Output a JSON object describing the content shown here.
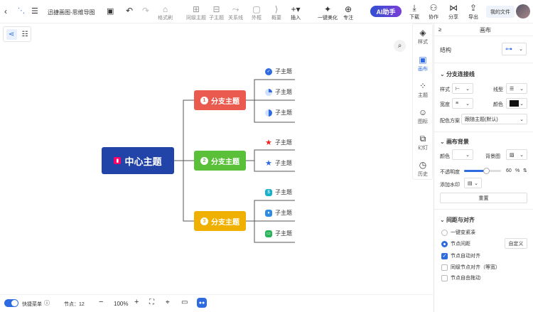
{
  "toolbar": {
    "title": "迅捷画图-思维导图",
    "tools": [
      "格式刷",
      "同级主题",
      "子主题",
      "关系线",
      "外框",
      "概要",
      "插入",
      "一键美化",
      "专注"
    ],
    "ai_label": "AI助手",
    "right": [
      "下载",
      "协作",
      "分享",
      "导出"
    ],
    "my_files": "我的文件"
  },
  "mindmap": {
    "center": "中心主题",
    "branches": [
      {
        "num": "1",
        "label": "分支主题",
        "color": "#ea5a4f",
        "subs": [
          "子主题",
          "子主题",
          "子主题"
        ]
      },
      {
        "num": "2",
        "label": "分支主题",
        "color": "#5ac039",
        "subs": [
          "子主题",
          "子主题"
        ]
      },
      {
        "num": "3",
        "label": "分支主题",
        "color": "#f0b000",
        "subs": [
          "子主题",
          "子主题",
          "子主题"
        ]
      }
    ]
  },
  "side_tabs": [
    "样式",
    "画布",
    "主题",
    "图标",
    "幻灯",
    "历史"
  ],
  "panel": {
    "header": "画布",
    "structure": "结构",
    "sec_lines": "分支连接线",
    "style": "样式",
    "line_type": "线型",
    "width": "宽度",
    "color": "颜色",
    "scheme": "配色方案",
    "scheme_value": "跟随主题(默认)",
    "sec_bg": "画布背景",
    "bg_color": "颜色",
    "bg_image": "背景图",
    "opacity": "不透明度",
    "opacity_value": "60",
    "opacity_unit": "%",
    "watermark": "添加水印",
    "reset": "重置",
    "sec_spacing": "间距与对齐",
    "compact": "一键变紧凑",
    "node_spacing": "节点间距",
    "custom": "自定义",
    "auto_align": "节点自动对齐",
    "same_level": "同级节点对齐（等宽）",
    "free_drag": "节点自由拖动"
  },
  "bottom": {
    "quick_menu": "快捷菜单",
    "nodes": "节点：12",
    "zoom": "100%"
  }
}
